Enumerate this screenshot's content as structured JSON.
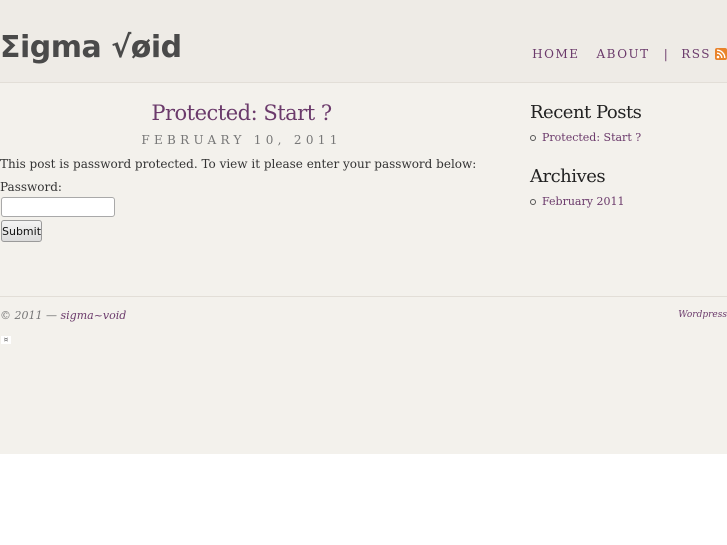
{
  "header": {
    "logo": "Σigma √øid",
    "nav": {
      "home": "HOME",
      "about": "ABOUT",
      "separator": "|",
      "rss": "RSS"
    }
  },
  "post": {
    "title": "Protected: Start ?",
    "date": "FEBRUARY 10, 2011",
    "protected_message": "This post is password protected. To view it please enter your password below:",
    "password_label": "Password:",
    "password_value": "",
    "submit_label": "Submit"
  },
  "sidebar": {
    "recent_posts": {
      "title": "Recent Posts",
      "items": [
        "Protected: Start ?"
      ]
    },
    "archives": {
      "title": "Archives",
      "items": [
        "February 2011"
      ]
    }
  },
  "footer": {
    "copyright": "© 2011 —",
    "site_link": "sigma~void",
    "powered_by": "Wordpress"
  },
  "colors": {
    "accent": "#6b3a6b",
    "background": "#f3f1ec",
    "rss": "#e9832b"
  },
  "icons": {
    "rss": "rss-feed-icon",
    "broken_image": "broken-image-icon"
  }
}
